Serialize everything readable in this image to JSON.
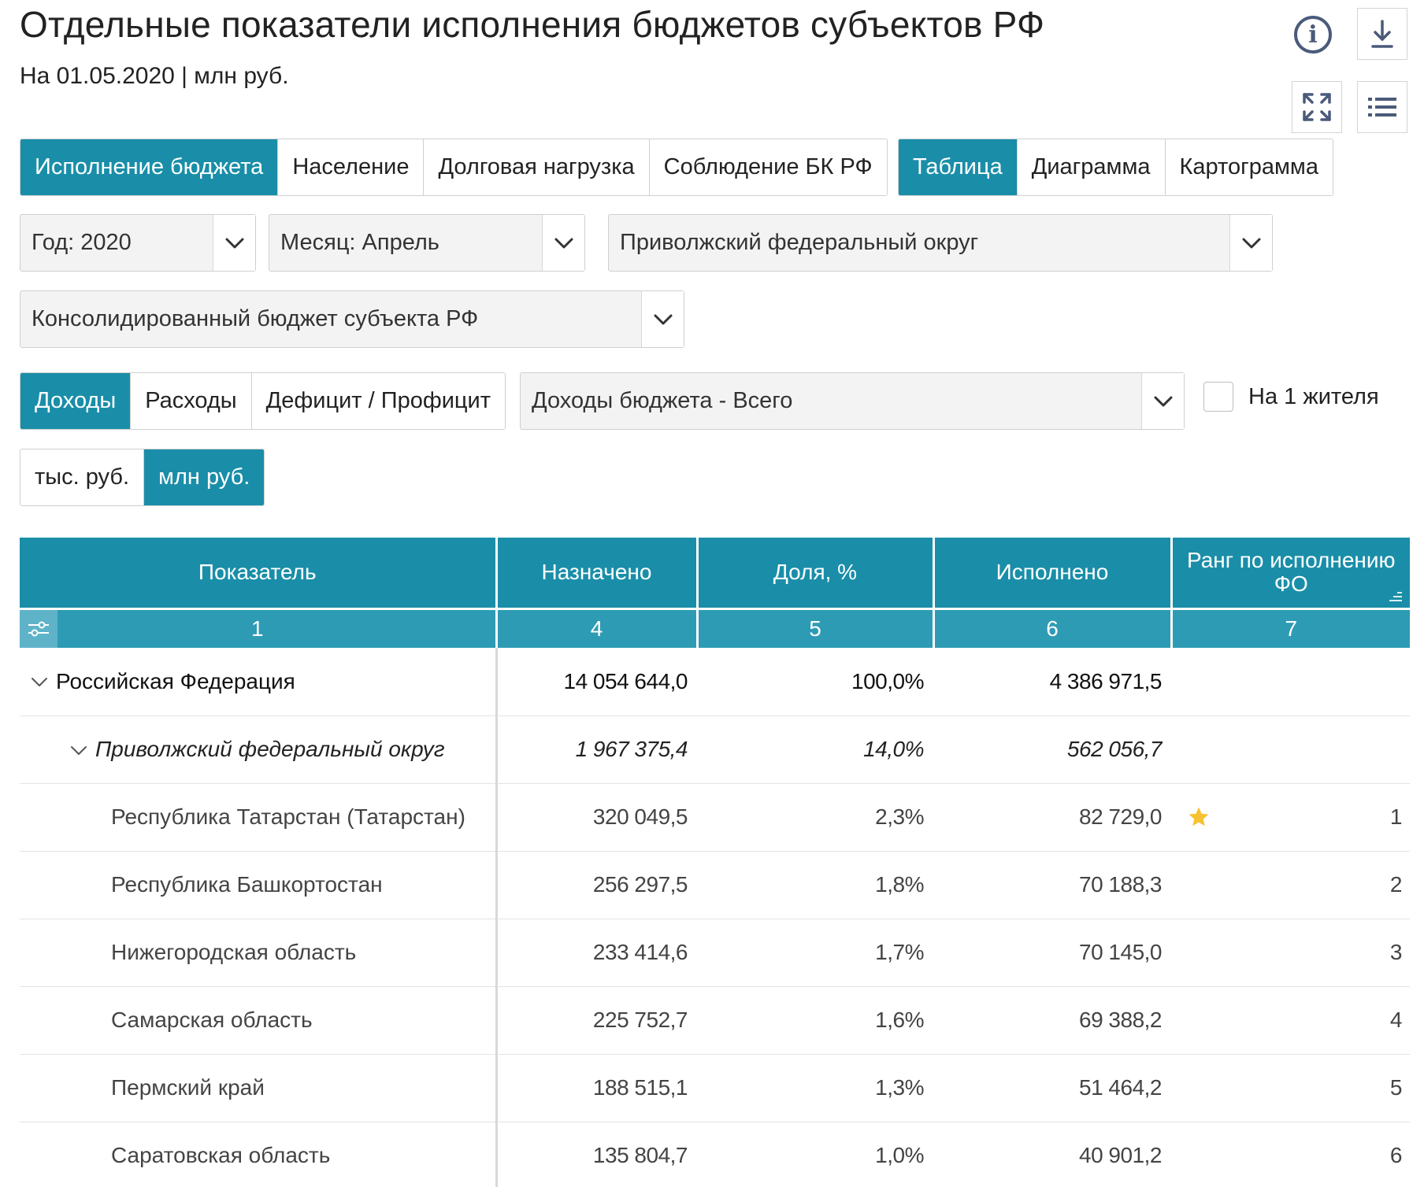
{
  "header": {
    "title": "Отдельные показатели исполнения бюджетов субъектов РФ",
    "subtitle": "На 01.05.2020 | млн руб.",
    "info_glyph": "i",
    "icons": [
      "info-icon",
      "download-icon",
      "fullscreen-icon",
      "list-icon"
    ]
  },
  "tabs_left": [
    "Исполнение бюджета",
    "Население",
    "Долговая нагрузка",
    "Соблюдение БК РФ"
  ],
  "tabs_left_active": 0,
  "tabs_right": [
    "Таблица",
    "Диаграмма",
    "Картограмма"
  ],
  "tabs_right_active": 0,
  "filters": {
    "year": "Год: 2020",
    "month": "Месяц: Апрель",
    "district": "Приволжский федеральный округ",
    "budget": "Консолидированный бюджет субъекта РФ",
    "indicator": "Доходы бюджета - Всего"
  },
  "type_tabs": [
    "Доходы",
    "Расходы",
    "Дефицит / Профицит"
  ],
  "type_tabs_active": 0,
  "per_capita_label": "На 1 жителя",
  "per_capita_checked": false,
  "unit_tabs": [
    "тыс. руб.",
    "млн руб."
  ],
  "unit_tabs_active": 1,
  "table": {
    "headers": [
      "Показатель",
      "Назначено",
      "Доля, %",
      "Исполнено",
      "Ранг по исполнению ФО"
    ],
    "col_numbers": [
      "1",
      "4",
      "5",
      "6",
      "7"
    ],
    "rows": [
      {
        "level": 0,
        "name": "Российская Федерация",
        "assigned": "14 054 644,0",
        "share": "100,0%",
        "executed": "4 386 971,5",
        "rank": "",
        "star": false,
        "expanded": true
      },
      {
        "level": 1,
        "name": "Приволжский федеральный округ",
        "assigned": "1 967 375,4",
        "share": "14,0%",
        "executed": "562 056,7",
        "rank": "",
        "star": false,
        "expanded": true
      },
      {
        "level": 2,
        "name": "Республика Татарстан (Татарстан)",
        "assigned": "320 049,5",
        "share": "2,3%",
        "executed": "82 729,0",
        "rank": "1",
        "star": true
      },
      {
        "level": 2,
        "name": "Республика Башкортостан",
        "assigned": "256 297,5",
        "share": "1,8%",
        "executed": "70 188,3",
        "rank": "2",
        "star": false
      },
      {
        "level": 2,
        "name": "Нижегородская область",
        "assigned": "233 414,6",
        "share": "1,7%",
        "executed": "70 145,0",
        "rank": "3",
        "star": false
      },
      {
        "level": 2,
        "name": "Самарская область",
        "assigned": "225 752,7",
        "share": "1,6%",
        "executed": "69 388,2",
        "rank": "4",
        "star": false
      },
      {
        "level": 2,
        "name": "Пермский край",
        "assigned": "188 515,1",
        "share": "1,3%",
        "executed": "51 464,2",
        "rank": "5",
        "star": false
      },
      {
        "level": 2,
        "name": "Саратовская область",
        "assigned": "135 804,7",
        "share": "1,0%",
        "executed": "40 901,2",
        "rank": "6",
        "star": false
      }
    ]
  },
  "colors": {
    "accent": "#1a8ea8",
    "header_row2": "#2e9bb5",
    "star": "#f6c232",
    "icon": "#4a5a7a"
  }
}
